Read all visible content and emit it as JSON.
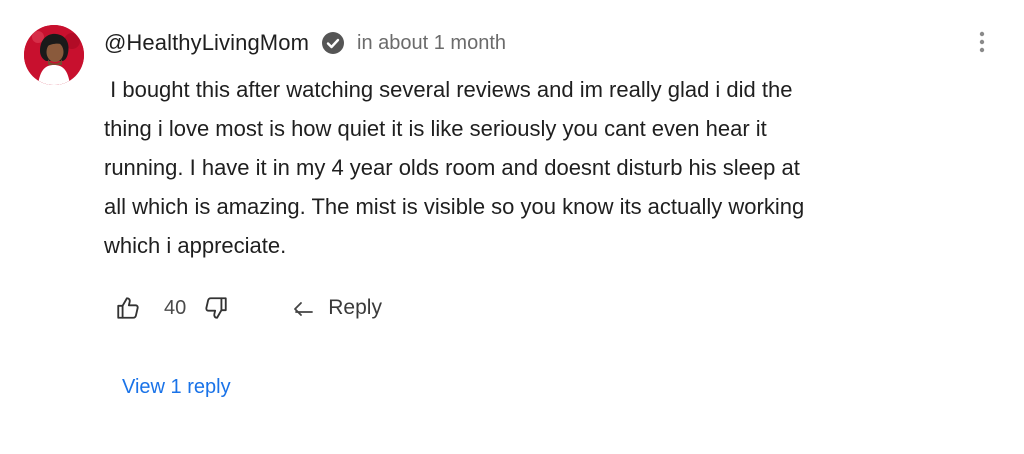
{
  "comment": {
    "author": "@HealthyLivingMom",
    "verified_icon": "verified-check-icon",
    "timestamp": "in about 1 month",
    "text": " I bought this after watching several reviews and im really glad i did the\nthing i love most is how quiet it is like seriously you cant even hear it\nrunning. I have it in my 4 year olds room and doesnt disturb his sleep at\nall which is amazing. The mist is visible so you know its actually working\nwhich i appreciate.",
    "likes": "40",
    "reply_label": "Reply",
    "view_replies_label": "View 1 reply",
    "icons": {
      "like": "thumbs-up-icon",
      "dislike": "thumbs-down-icon",
      "reply": "reply-arrow-icon",
      "more": "more-vertical-icon"
    },
    "colors": {
      "link": "#1a73e8",
      "avatar_bg": "#c8102e",
      "muted_text": "#6b6b6b"
    }
  }
}
